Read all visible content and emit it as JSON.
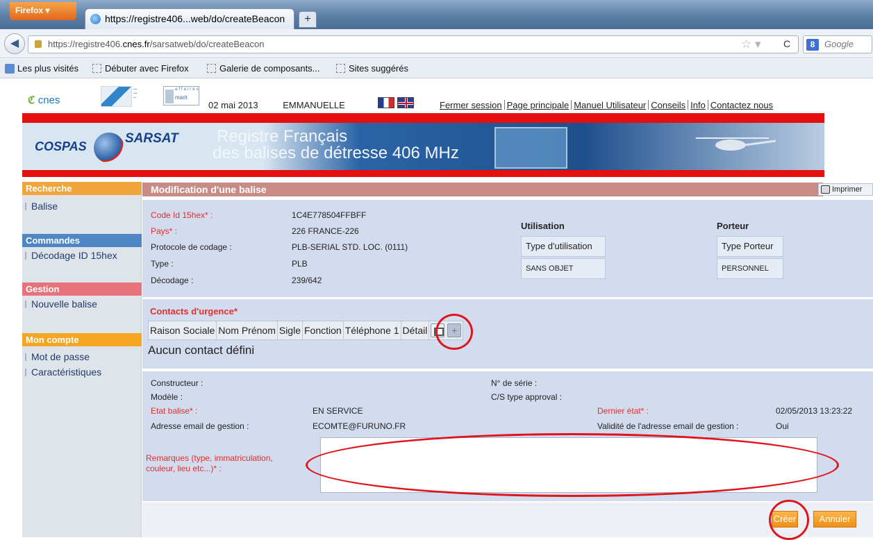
{
  "browser": {
    "app_button": "Firefox",
    "tab_title": "https://registre406...web/do/createBeacon",
    "new_tab": "+",
    "url_prefix": "https://registre406.",
    "url_host": "cnes.fr",
    "url_path": "/sarsatweb/do/createBeacon",
    "search_engine": "Google",
    "bookmarks": [
      "Les plus visités",
      "Débuter avec Firefox",
      "Galerie de composants...",
      "Sites suggérés"
    ]
  },
  "header": {
    "date": "02 mai 2013",
    "user": "EMMANUELLE COMTE",
    "logo_cnes": "cnes",
    "logo_mer_top": "affaires",
    "logo_mer": "marit",
    "links": [
      "Fermer session",
      "Page principale",
      "Manuel Utilisateur",
      "Conseils",
      "Info",
      "Contactez nous"
    ]
  },
  "banner": {
    "cospas": "COSPAS",
    "sarsat": "SARSAT",
    "title_line1": "Registre Français",
    "title_line2": "des balises de détresse 406 MHz"
  },
  "sidebar": {
    "sections": [
      {
        "title": "Recherche",
        "color": "#f0a63a",
        "items": [
          "Balise"
        ]
      },
      {
        "title": "Commandes",
        "color": "#4f86c4",
        "items": [
          "Décodage ID 15hex"
        ]
      },
      {
        "title": "Gestion",
        "color": "#e8727c",
        "items": [
          "Nouvelle balise"
        ]
      },
      {
        "title": "Mon compte",
        "color": "#f5a623",
        "items": [
          "Mot de passe",
          "Caractéristiques"
        ]
      }
    ]
  },
  "main": {
    "title": "Modification d'une balise",
    "print": "Imprimer",
    "beacon": {
      "code_label": "Code Id 15hex* :",
      "code_value": "1C4E778504FFBFF",
      "country_label": "Pays* :",
      "country_value": "226 FRANCE-226",
      "protocol_label": "Protocole de codage :",
      "protocol_value": "PLB-SERIAL STD. LOC. (0111)",
      "type_label": "Type :",
      "type_value": "PLB",
      "decoding_label": "Décodage :",
      "decoding_value": "239/642",
      "usage_title": "Utilisation",
      "usage_header": "Type d'utilisation",
      "usage_value": "SANS OBJET",
      "carrier_title": "Porteur",
      "carrier_header": "Type Porteur",
      "carrier_value": "PERSONNEL"
    },
    "contacts": {
      "title": "Contacts d'urgence*",
      "columns": [
        "Raison Sociale",
        "Nom Prénom",
        "Sigle",
        "Fonction",
        "Téléphone 1",
        "Détail"
      ],
      "empty": "Aucun contact défini"
    },
    "details": {
      "manufacturer_label": "Constructeur :",
      "model_label": "Modèle :",
      "serial_label": "N° de série :",
      "cs_label": "C/S type approval :",
      "status_label": "Etat balise* :",
      "status_value": "EN SERVICE",
      "last_state_label": "Dernier état* :",
      "last_state_value": "02/05/2013 13:23:22",
      "email_label": "Adresse email de gestion :",
      "email_value": "ECOMTE@FURUNO.FR",
      "email_valid_label": "Validité de l'adresse email de gestion :",
      "email_valid_value": "Oui",
      "remarks_label": "Remarques (type, immatriculation, couleur, lieu etc...)* :",
      "remarks_value": ""
    },
    "buttons": {
      "create": "Créer",
      "cancel": "Annuler"
    }
  }
}
